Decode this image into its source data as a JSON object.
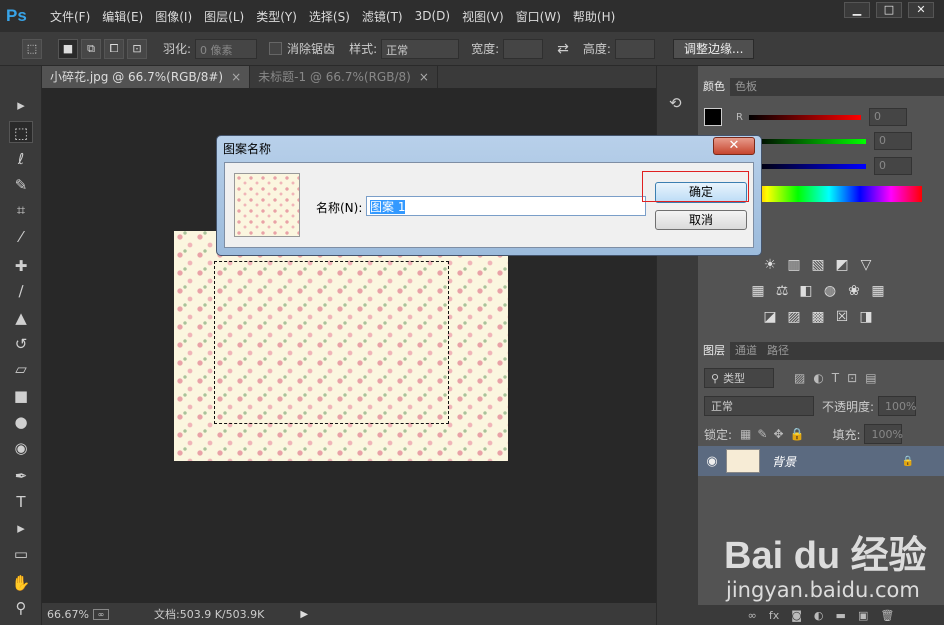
{
  "app": {
    "logo": "Ps"
  },
  "menu": [
    "文件(F)",
    "编辑(E)",
    "图像(I)",
    "图层(L)",
    "类型(Y)",
    "选择(S)",
    "滤镜(T)",
    "3D(D)",
    "视图(V)",
    "窗口(W)",
    "帮助(H)"
  ],
  "window_buttons": {
    "minimize": "▁",
    "restore": "□",
    "close": "✕"
  },
  "options": {
    "feather_label": "羽化:",
    "feather_value": "0 像素",
    "antialias_label": "消除锯齿",
    "style_label": "样式:",
    "style_value": "正常",
    "width_label": "宽度:",
    "height_label": "高度:",
    "refine_button": "调整边缘..."
  },
  "tabs": [
    {
      "label": "小碎花.jpg @ 66.7%(RGB/8#)",
      "close": "×"
    },
    {
      "label": "未标题-1 @ 66.7%(RGB/8)",
      "close": "×"
    }
  ],
  "status": {
    "zoom": "66.67%",
    "doc": "文档:503.9 K/503.9K"
  },
  "color_panel": {
    "tabs": [
      "颜色",
      "色板"
    ],
    "r_label": "R",
    "r_value": "0",
    "g_value": "0",
    "b_value": "0"
  },
  "layers_panel": {
    "tabs": [
      "图层",
      "通道",
      "路径"
    ],
    "filter_label": "类型",
    "blend_mode": "正常",
    "opacity_label": "不透明度:",
    "opacity_value": "100%",
    "lock_label": "锁定:",
    "fill_label": "填充:",
    "fill_value": "100%",
    "layer_name": "背景"
  },
  "dialog": {
    "title": "图案名称",
    "name_label": "名称(N):",
    "name_value": "图案 1",
    "ok": "确定",
    "cancel": "取消",
    "close": "✕"
  },
  "watermark": {
    "main": "Bai du 经验",
    "url": "jingyan.baidu.com"
  }
}
